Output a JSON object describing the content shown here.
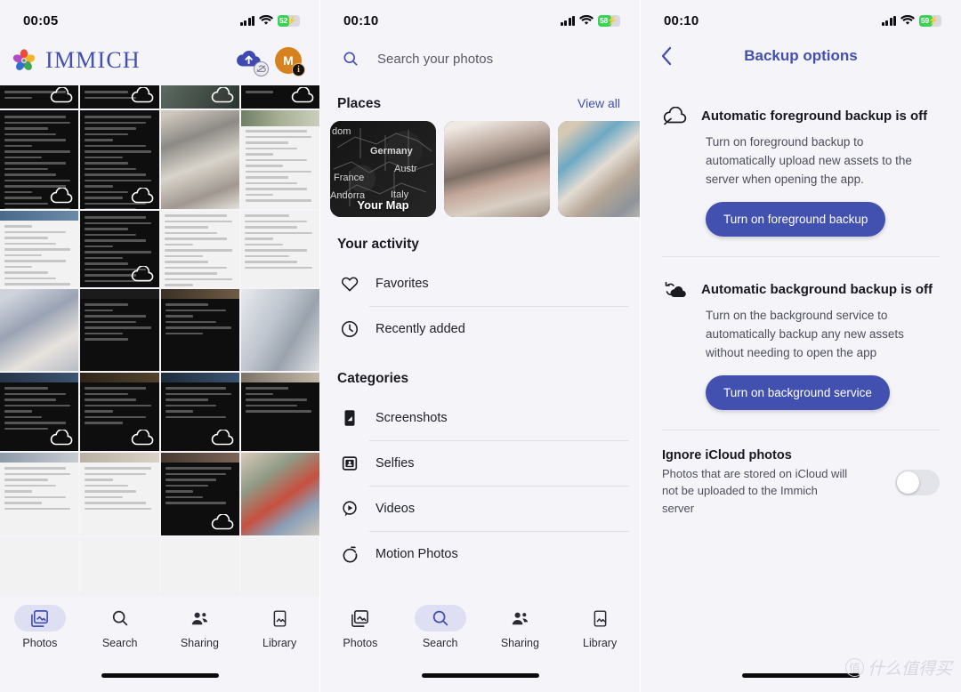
{
  "screens": {
    "photos": {
      "status": {
        "time": "00:05",
        "battery": "52",
        "battery_pct_num": 52,
        "charging": true
      },
      "app_name": "IMMICH",
      "header_icons": {
        "backup": "cloud-upload-disabled-icon",
        "avatar_initial": "M",
        "avatar_badge": "info-icon"
      },
      "nav": [
        {
          "label": "Photos",
          "icon": "photos-icon",
          "active": true
        },
        {
          "label": "Search",
          "icon": "search-icon",
          "active": false
        },
        {
          "label": "Sharing",
          "icon": "sharing-icon",
          "active": false
        },
        {
          "label": "Library",
          "icon": "library-icon",
          "active": false
        }
      ]
    },
    "search": {
      "status": {
        "time": "00:10",
        "battery": "58",
        "battery_pct_num": 58,
        "charging": true
      },
      "search_placeholder": "Search your photos",
      "places": {
        "title": "Places",
        "link": "View all",
        "items": [
          {
            "name": "Your Map",
            "labels": [
              "dom",
              "Germany",
              "France",
              "Austr",
              "Andorra",
              "Italy"
            ]
          },
          {
            "name": "",
            "labels": []
          },
          {
            "name": "",
            "labels": []
          }
        ]
      },
      "activity": {
        "title": "Your activity",
        "items": [
          {
            "label": "Favorites",
            "icon": "heart-icon"
          },
          {
            "label": "Recently added",
            "icon": "clock-icon"
          }
        ]
      },
      "categories": {
        "title": "Categories",
        "items": [
          {
            "label": "Screenshots",
            "icon": "screenshot-icon"
          },
          {
            "label": "Selfies",
            "icon": "selfie-icon"
          },
          {
            "label": "Videos",
            "icon": "video-icon"
          },
          {
            "label": "Motion Photos",
            "icon": "motion-photo-icon"
          }
        ]
      },
      "nav": [
        {
          "label": "Photos",
          "icon": "photos-icon",
          "active": false
        },
        {
          "label": "Search",
          "icon": "search-icon",
          "active": true
        },
        {
          "label": "Sharing",
          "icon": "sharing-icon",
          "active": false
        },
        {
          "label": "Library",
          "icon": "library-icon",
          "active": false
        }
      ]
    },
    "backup": {
      "status": {
        "time": "00:10",
        "battery": "59",
        "battery_pct_num": 59,
        "charging": true
      },
      "title": "Backup options",
      "back_icon": "chevron-left-icon",
      "foreground": {
        "icon": "cloud-off-icon",
        "title": "Automatic foreground backup is off",
        "description": "Turn on foreground backup to automatically upload new assets to the server when opening the app.",
        "button": "Turn on foreground backup"
      },
      "background": {
        "icon": "cloud-sync-icon",
        "title": "Automatic background backup is off",
        "description": "Turn on the background service to automatically backup any new assets without needing to open the app",
        "button": "Turn on background service"
      },
      "icloud": {
        "title": "Ignore iCloud photos",
        "description": "Photos that are stored on iCloud will not be uploaded to the Immich server",
        "toggle_on": false
      }
    }
  },
  "watermark": {
    "badge": "值",
    "text": "什么值得买"
  },
  "colors": {
    "accent": "#4250af",
    "background": "#f4f4f9",
    "battery_green": "#3ad156",
    "avatar_orange": "#d8821f",
    "active_pill": "#dfdff4"
  }
}
